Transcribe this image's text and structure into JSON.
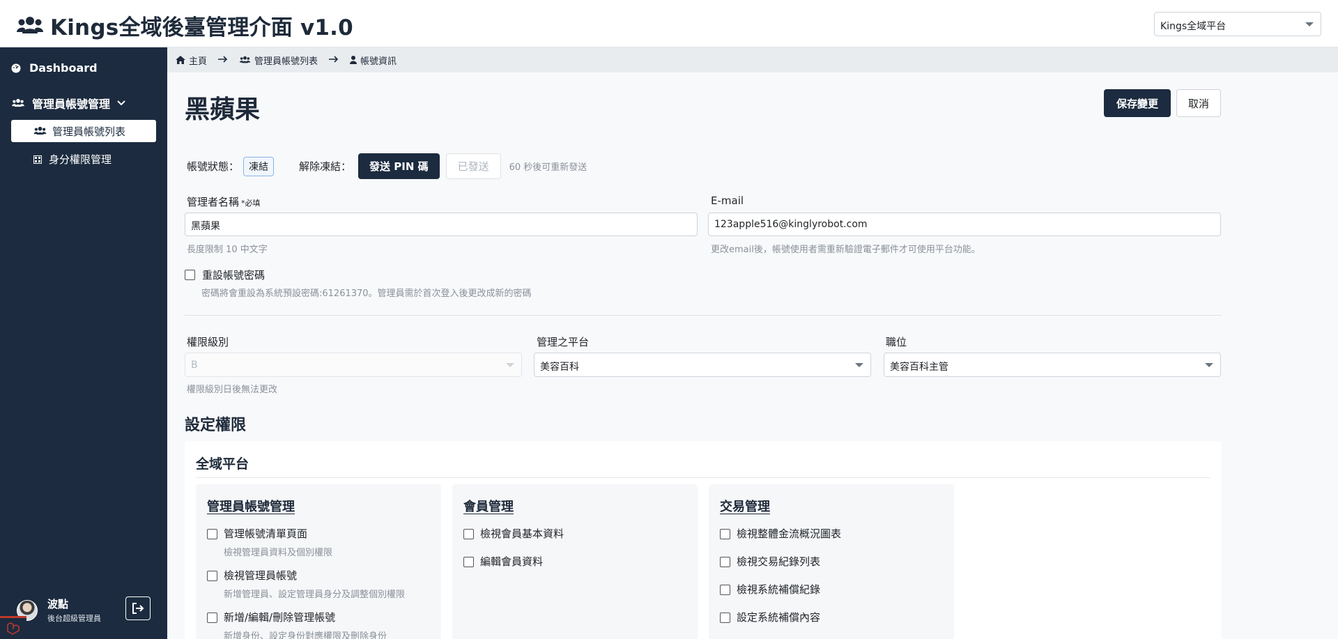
{
  "header": {
    "title": "Kings全域後臺管理介面 v1.0",
    "platform_select": "Kings全域平台"
  },
  "sidebar": {
    "dashboard": "Dashboard",
    "admin_section": "管理員帳號管理",
    "sub_items": [
      "管理員帳號列表",
      "身分權限管理"
    ],
    "user": {
      "name": "波點",
      "role": "後台超級管理員"
    }
  },
  "breadcrumb": [
    "主頁",
    "管理員帳號列表",
    "帳號資訊"
  ],
  "page": {
    "title": "黑蘋果",
    "save_label": "保存變更",
    "cancel_label": "取消"
  },
  "status": {
    "label": "帳號狀態：",
    "value": "凍結",
    "unfreeze_label": "解除凍結：",
    "send_pin": "發送 PIN 碼",
    "sent": "已發送",
    "resend_hint": "60 秒後可重新發送"
  },
  "form": {
    "name_label": "管理者名稱",
    "name_required": "*必填",
    "name_value": "黑蘋果",
    "name_hint": "長度限制 10 中文字",
    "email_label": "E-mail",
    "email_value": "123apple516@kinglyrobot.com",
    "email_hint": "更改email後，帳號使用者需重新驗證電子郵件才可使用平台功能。",
    "reset_label": "重設帳號密碼",
    "reset_hint": "密碼將會重設為系統預設密碼:61261370。管理員需於首次登入後更改成新的密碼",
    "level_label": "權限級別",
    "level_value": "B",
    "level_hint": "權限級別日後無法更改",
    "platform_label": "管理之平台",
    "platform_value": "美容百科",
    "position_label": "職位",
    "position_value": "美容百科主管"
  },
  "permissions": {
    "section_title": "設定權限",
    "card_title": "全域平台",
    "groups": [
      {
        "title": "管理員帳號管理",
        "items": [
          {
            "label": "管理帳號清單頁面",
            "desc": "檢視管理員資料及個別權限"
          },
          {
            "label": "檢視管理員帳號",
            "desc": "新增管理員、設定管理員身分及調整個別權限"
          },
          {
            "label": "新增/編輯/刪除管理帳號",
            "desc": "新增身份、設定身份對應權限及刪除身份"
          }
        ]
      },
      {
        "title": "會員管理",
        "items": [
          {
            "label": "檢視會員基本資料",
            "desc": ""
          },
          {
            "label": "編輯會員資料",
            "desc": ""
          }
        ]
      },
      {
        "title": "交易管理",
        "items": [
          {
            "label": "檢視整體金流概況圖表",
            "desc": ""
          },
          {
            "label": "檢視交易紀錄列表",
            "desc": ""
          },
          {
            "label": "檢視系統補償紀錄",
            "desc": ""
          },
          {
            "label": "設定系統補償內容",
            "desc": ""
          }
        ]
      }
    ]
  }
}
